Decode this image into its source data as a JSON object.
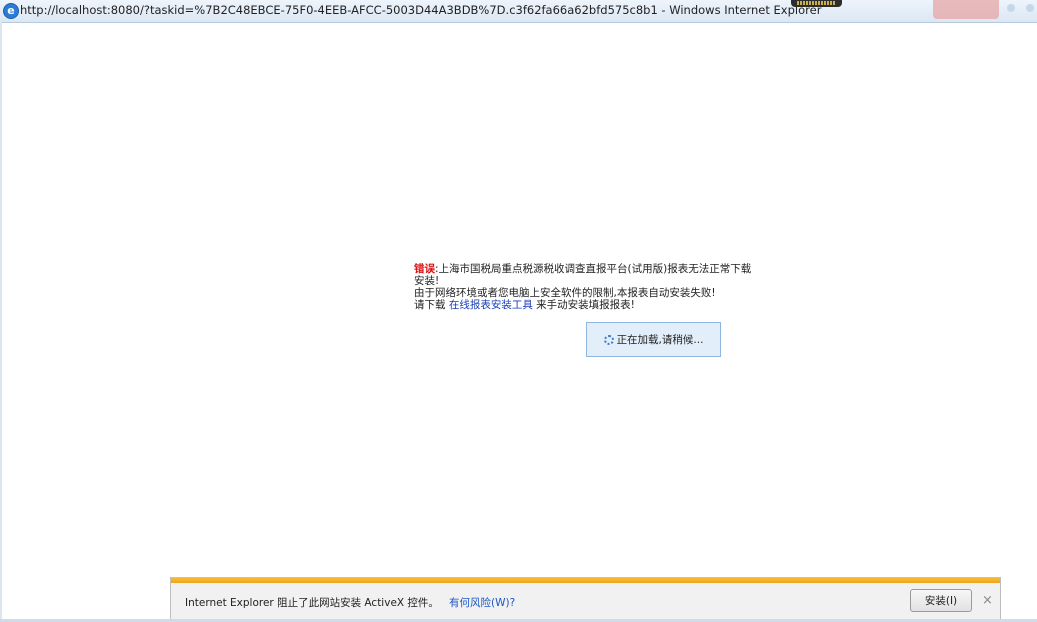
{
  "window": {
    "title": "http://localhost:8080/?taskid=%7B2C48EBCE-75F0-4EEB-AFCC-5003D44A3BDB%7D.c3f62fa66a62bfd575c8b1 - Windows Internet Explorer"
  },
  "content": {
    "error_label": "错误",
    "error_colon": ":",
    "error_message": "上海市国税局重点税源税收调查直报平台(试用版)报表无法正常下载安装!",
    "reason_line": "由于网络环境或者您电脑上安全软件的限制,本报表自动安装失败!",
    "download_prefix": "请下载 ",
    "download_link": "在线报表安装工具",
    "download_suffix": " 来手动安装填报报表!",
    "loading_text": "正在加载,请稍候..."
  },
  "notification": {
    "text": "Internet Explorer 阻止了此网站安装 ActiveX 控件。",
    "risk_link": "有何风险(W)?",
    "install_button": "安装(I)",
    "close": "×"
  },
  "colors": {
    "error": "#dd1111",
    "link": "#1a3fb8",
    "notify_strip": "#f0a51d"
  }
}
